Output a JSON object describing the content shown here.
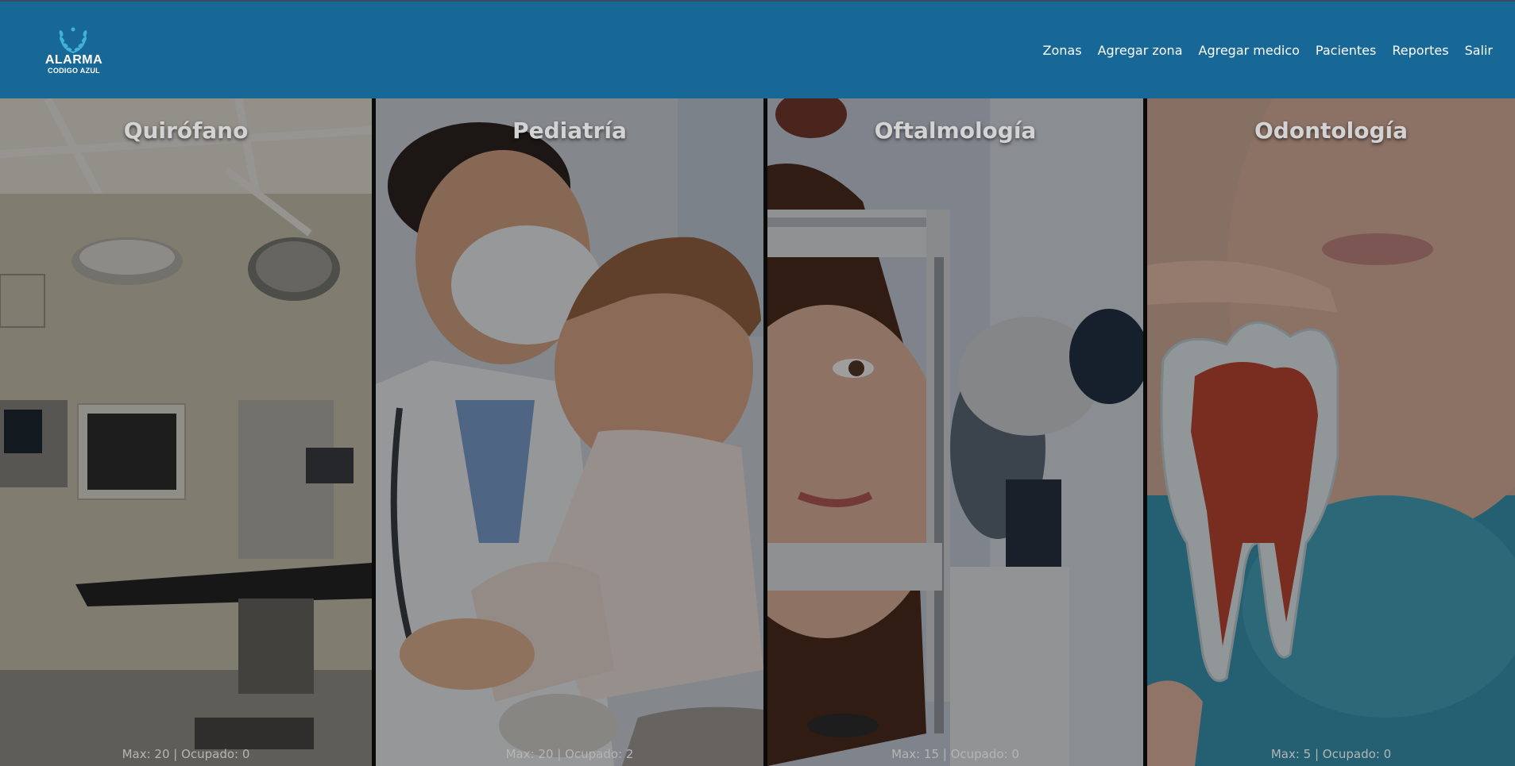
{
  "brand": {
    "title": "ALARMA",
    "subtitle": "CODIGO AZUL",
    "icon": "laurel-wreath-icon"
  },
  "nav": [
    {
      "label": "Zonas"
    },
    {
      "label": "Agregar zona"
    },
    {
      "label": "Agregar medico"
    },
    {
      "label": "Pacientes"
    },
    {
      "label": "Reportes"
    },
    {
      "label": "Salir"
    }
  ],
  "zones": [
    {
      "title": "Quirófano",
      "stats": "Max: 20 | Ocupado: 0",
      "image": "operating-room-photo"
    },
    {
      "title": "Pediatría",
      "stats": "Max: 20 | Ocupado: 2",
      "image": "pediatrician-with-baby-photo"
    },
    {
      "title": "Oftalmología",
      "stats": "Max: 15 | Ocupado: 0",
      "image": "eye-exam-photo"
    },
    {
      "title": "Odontología",
      "stats": "Max: 5 | Ocupado: 0",
      "image": "tooth-model-photo"
    }
  ],
  "colors": {
    "header": "#176797",
    "title_text": "#d3d3d3"
  }
}
